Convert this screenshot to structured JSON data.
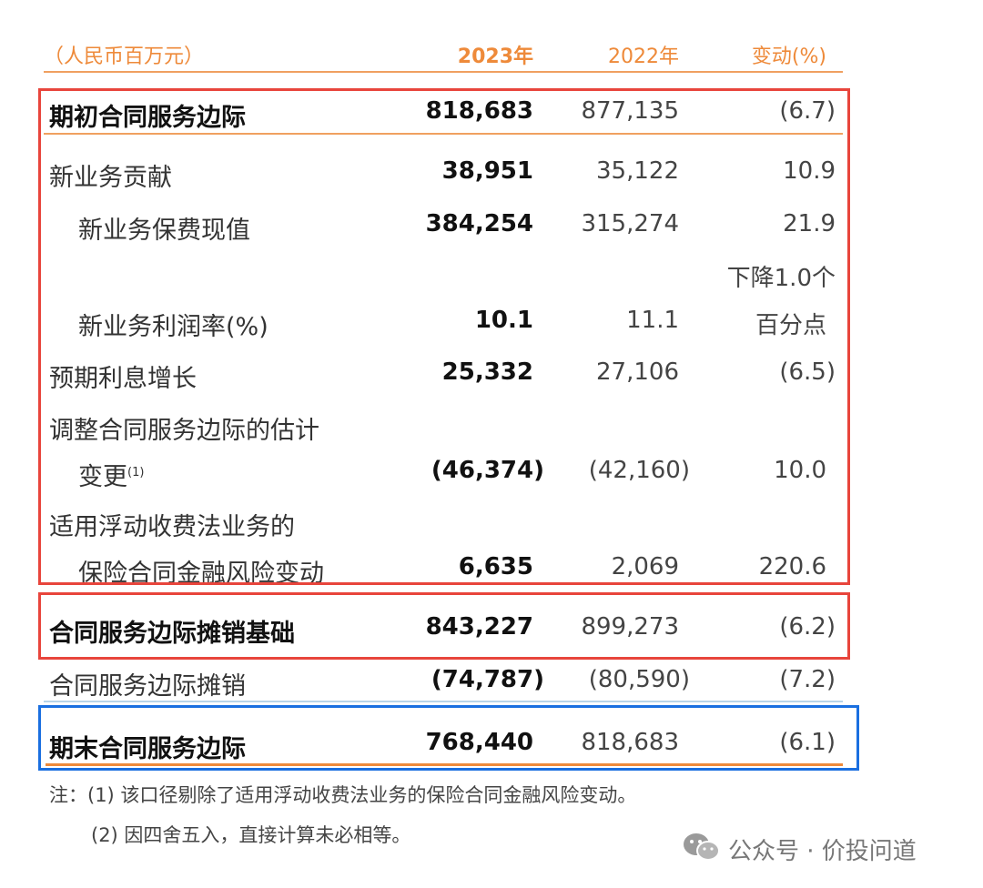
{
  "header": {
    "unit": "（人民币百万元）",
    "col_2023": "2023年",
    "col_2022": "2022年",
    "col_change": "变动(%)"
  },
  "rows": [
    {
      "label": "期初合同服务边际",
      "v2023": "818,683",
      "v2022": "877,135",
      "change": "(6.7)"
    },
    {
      "label": "新业务贡献",
      "v2023": "38,951",
      "v2022": "35,122",
      "change": "10.9"
    },
    {
      "label": "新业务保费现值",
      "v2023": "384,254",
      "v2022": "315,274",
      "change": "21.9"
    },
    {
      "label": "新业务利润率(%)",
      "v2023": "10.1",
      "v2022": "11.1",
      "change_line1": "下降1.0个",
      "change_line2": "百分点"
    },
    {
      "label": "预期利息增长",
      "v2023": "25,332",
      "v2022": "27,106",
      "change": "(6.5)"
    },
    {
      "label_line1": "调整合同服务边际的估计",
      "label_line2": "变更",
      "label_sup": "(1)",
      "v2023": "(46,374)",
      "v2022": "(42,160)",
      "change": "10.0"
    },
    {
      "label_line1": "适用浮动收费法业务的",
      "label_line2": "保险合同金融风险变动",
      "v2023": "6,635",
      "v2022": "2,069",
      "change": "220.6"
    },
    {
      "label": "合同服务边际摊销基础",
      "v2023": "843,227",
      "v2022": "899,273",
      "change": "(6.2)"
    },
    {
      "label": "合同服务边际摊销",
      "v2023": "(74,787)",
      "v2022": "(80,590)",
      "change": "(7.2)"
    },
    {
      "label": "期末合同服务边际",
      "v2023": "768,440",
      "v2022": "818,683",
      "change": "(6.1)"
    }
  ],
  "notes": {
    "note1": "注：(1) 该口径剔除了适用浮动收费法业务的保险合同金融风险变动。",
    "note2": "(2) 因四舍五入，直接计算未必相等。"
  },
  "watermark": {
    "icon": "wechat-icon",
    "text": "公众号 · 价投问道"
  },
  "colors": {
    "accent_orange": "#ee8a3a",
    "box_red": "#e8453c",
    "box_blue": "#1a6fe0"
  }
}
